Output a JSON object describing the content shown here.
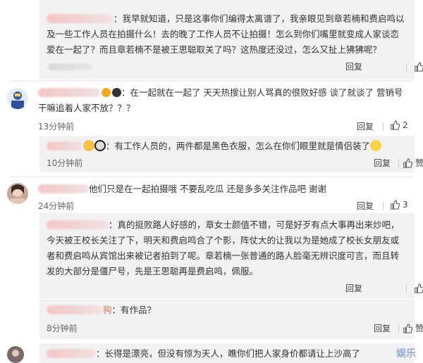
{
  "comments": [
    {
      "id": "r1",
      "text": "：我早就知道，只是这事你们编得太离谱了，我亲眼见到章若楠和费启鸣以及一些工作人员在拍摄什么！去的晚了工作人员不让拍摄！怎么到你们嘴里就变成人家谈恋爱在一起了？而且章若楠不是被王思聪取关了吗？这热度还没过，怎么又扯上狒狒呢？",
      "reply_label": "回复",
      "like_label": "赞"
    },
    {
      "id": "c1",
      "text": "：在一起就在一起了 天天热搜让别人骂真的很败好感 谈了就谈了 营销号干嘛追着人家不放？？？",
      "time": "13分钟前",
      "reply_label": "回复",
      "like_count": "2"
    },
    {
      "id": "r2",
      "text": "：有工作人员的，两件都是黑色衣服，怎么在你们眼里就是情侣装了",
      "time": "10分钟前",
      "reply_label": "回复",
      "like_label": "赞"
    },
    {
      "id": "c2",
      "text": "他们只是在一起拍摄哦 不要乱吃瓜 还是多多关注作品吧 谢谢",
      "time": "24分钟前",
      "reply_label": "回复",
      "like_count": "3"
    },
    {
      "id": "r3",
      "text": "：真的挺败路人好感的，章女士颜值不错，可是好歹有点大事再出来炒吧，今天被王校长关注了下，明天和费启鸣合了个影，阵仗大的让我以为是她成了校长女朋友或者和费启鸣从宾馆出来被记者拍到了呢。章若楠一张普通的路人脸毫无辨识度可言，而且转发的大部分是僵尸号，先是王思聪再是费启鸣，佩服。",
      "reply_label": "回复",
      "like_label": "赞"
    },
    {
      "id": "r4",
      "name_suffix": "狗",
      "text": "：有作品？",
      "time": "8分钟前",
      "reply_label": "回复",
      "like_label": "赞"
    },
    {
      "id": "r5",
      "text": "：长得是漂亮，但没有惊为天人，瞧你们把人家身价都请让上沙高了"
    }
  ],
  "watermark": "娱乐",
  "colors": {
    "reply_bg": "#f2f2f5",
    "text": "#333333",
    "meta": "#666666"
  }
}
